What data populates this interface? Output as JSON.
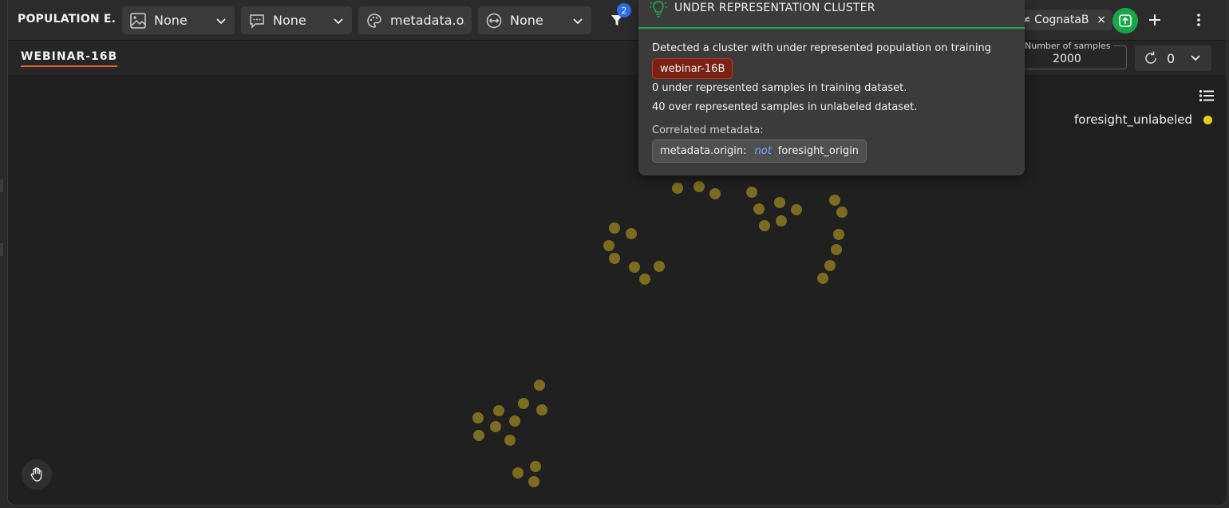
{
  "header": {
    "title": "POPULATION E...",
    "dropdowns": [
      {
        "icon": "image-icon",
        "value": "None"
      },
      {
        "icon": "comment-icon",
        "value": "None"
      },
      {
        "icon": "palette-icon",
        "value": "metadata.o..."
      },
      {
        "icon": "resize-icon",
        "value": "None"
      }
    ],
    "filter_count": "2",
    "filter_tag": "≠ CognataB",
    "filter_tag_close": "×"
  },
  "subbar": {
    "tab": "WEBINAR-16B",
    "samples_label": "Number of samples",
    "samples_value": "2000",
    "refresh_value": "0"
  },
  "legend": {
    "items": [
      {
        "label": "foresight_unlabeled",
        "color": "#e1d024"
      }
    ]
  },
  "popup": {
    "title": "UNDER REPRESENTATION CLUSTER",
    "line1": "Detected a cluster with under represented population on training",
    "tag": "webinar-16B",
    "line2": "0 under represented samples in training dataset.",
    "line3": "40 over represented samples in unlabeled dataset.",
    "correlated_label": "Correlated metadata:",
    "meta_key": "metadata.origin:",
    "meta_op": "not",
    "meta_value": "foresight_origin",
    "accent": "#1fa84f"
  },
  "scatter": {
    "color": "#7a6d1f"
  }
}
